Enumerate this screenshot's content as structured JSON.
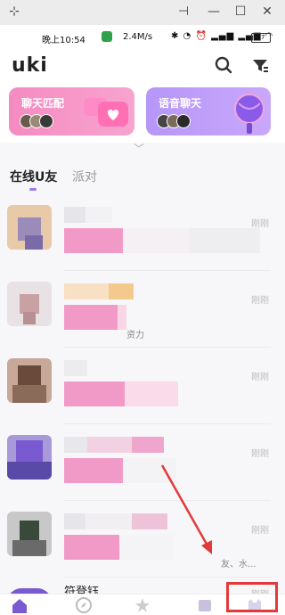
{
  "window": {
    "pin_icon": "pin-icon",
    "min_icon": "minimize-icon",
    "max_icon": "maximize-icon",
    "close_icon": "close-icon"
  },
  "status_bar": {
    "time": "晚上10:54",
    "speed": "2.4M/s",
    "battery": "77"
  },
  "header": {
    "logo": "uki",
    "search_icon": "search-icon",
    "filter_icon": "filter-icon"
  },
  "banners": [
    {
      "title": "聊天匹配",
      "color": "#f58bc1"
    },
    {
      "title": "语音聊天",
      "color": "#b696f7"
    }
  ],
  "tabs": [
    {
      "label": "在线U友",
      "active": true
    },
    {
      "label": "派对",
      "active": false
    }
  ],
  "conversations": [
    {
      "time": "刚刚",
      "snippet": ""
    },
    {
      "time": "刚刚",
      "snippet": "资力"
    },
    {
      "time": "刚刚",
      "snippet": ""
    },
    {
      "time": "刚刚",
      "snippet": ""
    },
    {
      "time": "刚刚",
      "snippet": "友、水..."
    }
  ],
  "partial_row": {
    "name": "符登钰",
    "time": "刚刚"
  },
  "colors": {
    "accent": "#9a7bf0",
    "annotation": "#e23a3a"
  }
}
